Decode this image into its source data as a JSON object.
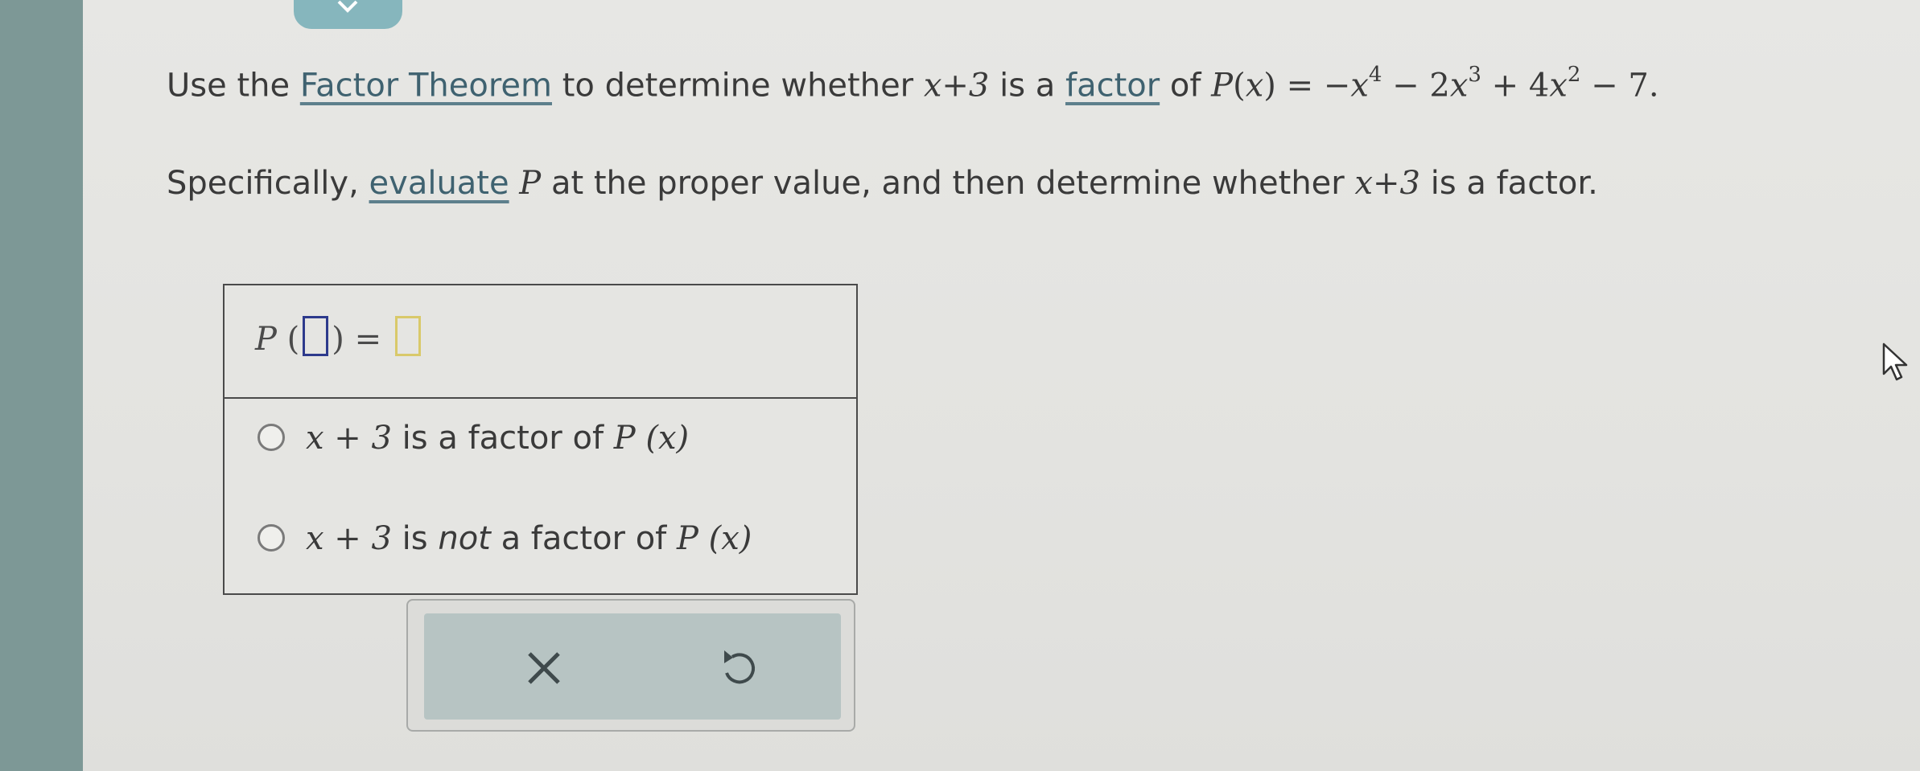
{
  "question": {
    "line1": {
      "t1": "Use the ",
      "link1": "Factor Theorem",
      "t2": " to determine whether ",
      "m_xp3": "x+3",
      "t3": " is a ",
      "link2": "factor",
      "t4": " of ",
      "m_P": "P",
      "m_lp": "(",
      "m_x": "x",
      "m_rp": ")",
      "m_eq": " = −",
      "m_x4": "x",
      "e4": "4",
      "m_mid1": " − 2",
      "m_x3": "x",
      "e3": "3",
      "m_mid2": " + 4",
      "m_x2": "x",
      "e2": "2",
      "m_end": " − 7."
    },
    "line2": {
      "t1": "Specifically, ",
      "link": "evaluate",
      "m_P": " P",
      "t2": " at the proper value, and then determine whether ",
      "m_xp3": "x+3",
      "t3": " is a factor."
    }
  },
  "answer": {
    "eval": {
      "P": "P",
      "lp": " (",
      "rp": ") ",
      "eq": "=",
      "input_value": "",
      "result_value": ""
    },
    "options": [
      {
        "pre": "x + 3",
        "mid": " is a factor of ",
        "P": "P",
        "arg": "(x)"
      },
      {
        "pre": "x + 3",
        "is": " is ",
        "not": "not",
        "mid": " a factor of ",
        "P": "P",
        "arg": "(x)"
      }
    ],
    "selected_option": null
  },
  "buttons": {
    "clear_icon": "close-icon",
    "undo_icon": "undo-icon"
  },
  "colors": {
    "link": "#3f6270",
    "input_border": "#2d3a8c",
    "button_bar": "#b7c4c3",
    "left_strip": "#7d9896"
  }
}
